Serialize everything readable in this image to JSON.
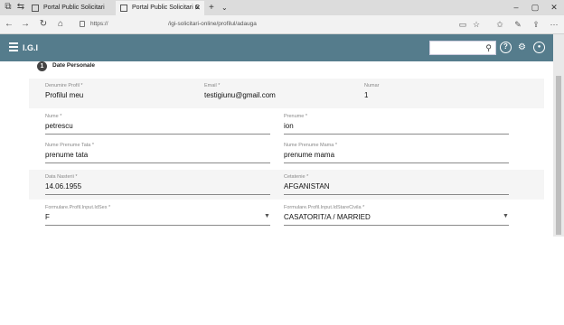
{
  "browser": {
    "tabs": [
      {
        "title": "Portal Public Solicitari Onlin",
        "active": false
      },
      {
        "title": "Portal Public Solicitari C",
        "active": true
      }
    ],
    "new_tab": "+",
    "tab_dropdown": "⌄",
    "url_protocol": "https://",
    "url_path": "/igi-solicitari-online/profilul/adauga",
    "window_controls": [
      "–",
      "▢",
      "✕"
    ],
    "nav": [
      "←",
      "→",
      "↻",
      "⌂"
    ]
  },
  "app": {
    "title": "I.G.I",
    "search_placeholder": "",
    "help_glyph": "?"
  },
  "section": {
    "step": "1",
    "title": "Date Personale"
  },
  "fields": {
    "profil_name": {
      "label": "Denumire Profil *",
      "value": "Profilul meu"
    },
    "email": {
      "label": "Email *",
      "value": "testigiunu@gmail.com"
    },
    "numar": {
      "label": "Numar",
      "value": "1"
    },
    "nume": {
      "label": "Nume *",
      "value": "petrescu"
    },
    "prenume": {
      "label": "Prenume *",
      "value": "ion"
    },
    "prenume_tata": {
      "label": "Nume Prenume Tata *",
      "value": "prenume tata"
    },
    "prenume_mama": {
      "label": "Nume Prenume Mama *",
      "value": "prenume mama"
    },
    "data_nasterii": {
      "label": "Data Nasterii *",
      "value": "14.06.1955"
    },
    "cetatenie": {
      "label": "Cetatenie *",
      "value": "AFGANISTAN"
    },
    "sex": {
      "label": "Formulare.Profil.Input.IdSex *",
      "value": "F"
    },
    "stare_civila": {
      "label": "Formulare.Profil.Input.IdStareCivila *",
      "value": "CASATORIT/A / MARRIED"
    }
  },
  "colors": {
    "header": "#557c8c",
    "band": "#f5f5f5"
  }
}
